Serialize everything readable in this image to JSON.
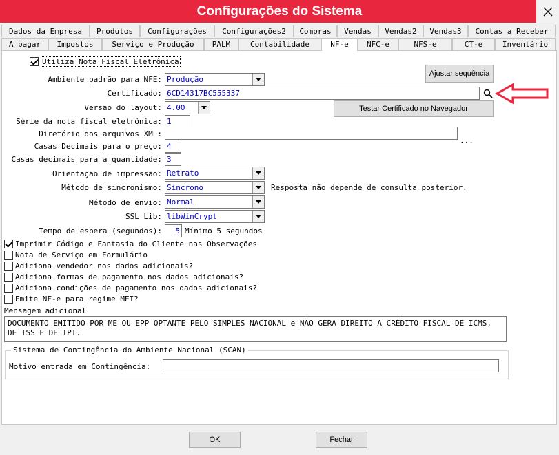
{
  "window": {
    "title": "Configurações do Sistema",
    "close_icon": "close-icon",
    "titlebar_color": "#e8273f"
  },
  "tabs_row1": [
    "Dados da Empresa",
    "Produtos",
    "Configurações",
    "Configurações2",
    "Compras",
    "Vendas",
    "Vendas2",
    "Vendas3",
    "Contas a Receber"
  ],
  "tabs_row2": [
    "A pagar",
    "Impostos",
    "Serviço e Produção",
    "PALM",
    "Contabilidade",
    "NF-e",
    "NFC-e",
    "NFS-e",
    "CT-e",
    "Inventário"
  ],
  "active_tab": "NF-e",
  "form": {
    "utiliza_nfe": {
      "label": "Utiliza Nota Fiscal Eletrônica",
      "checked": true
    },
    "ajustar_button": "Ajustar sequência",
    "ambiente": {
      "label": "Ambiente padrão para NFE:",
      "value": "Produção"
    },
    "certificado": {
      "label": "Certificado:",
      "value": "6CD14317BC555337",
      "search_icon": "search-icon"
    },
    "versao": {
      "label": "Versão do layout:",
      "value": "4.00"
    },
    "testar_button": "Testar Certificado no Navegador",
    "serie": {
      "label": "Série da nota fiscal eletrônica:",
      "value": "1"
    },
    "diretorio": {
      "label": "Diretório dos arquivos XML:",
      "value": "",
      "browse": "..."
    },
    "casas_preco": {
      "label": "Casas Decimais para o preço:",
      "value": "4"
    },
    "casas_qtd": {
      "label": "Casas decimais para a quantidade:",
      "value": "3"
    },
    "orientacao": {
      "label": "Orientação de impressão:",
      "value": "Retrato"
    },
    "sincronismo": {
      "label": "Método de sincronismo:",
      "value": "Síncrono",
      "hint": "Resposta não depende de consulta posterior."
    },
    "envio": {
      "label": "Método de envio:",
      "value": "Normal"
    },
    "ssl": {
      "label": "SSL Lib:",
      "value": "libWinCrypt"
    },
    "tempo": {
      "label": "Tempo de espera (segundos):",
      "value": "5",
      "hint": "Mínimo 5 segundos"
    },
    "checkboxes": [
      {
        "label": "Imprimir Código e Fantasia do Cliente nas Observações",
        "checked": true
      },
      {
        "label": "Nota de Serviço em Formulário",
        "checked": false
      },
      {
        "label": "Adiciona vendedor nos dados adicionais?",
        "checked": false
      },
      {
        "label": "Adiciona formas de pagamento nos dados adicionais?",
        "checked": false
      },
      {
        "label": "Adiciona condições de pagamento nos dados adicionais?",
        "checked": false
      },
      {
        "label": "Emite NF-e para regime MEI?",
        "checked": false
      }
    ],
    "mensagem": {
      "label": "Mensagem adicional",
      "value": "DOCUMENTO EMITIDO POR ME OU EPP OPTANTE PELO SIMPLES NACIONAL e NÃO GERA DIREITO A CRÉDITO FISCAL DE ICMS, DE ISS E DE IPI."
    },
    "scan": {
      "title": "Sistema de Contingência do Ambiente Nacional (SCAN)",
      "motivo_label": "Motivo entrada em Contingência:",
      "motivo_value": ""
    }
  },
  "footer": {
    "ok": "OK",
    "fechar": "Fechar"
  },
  "annotation": {
    "arrow_color": "#e8273f",
    "icon": "left-arrow-icon"
  }
}
